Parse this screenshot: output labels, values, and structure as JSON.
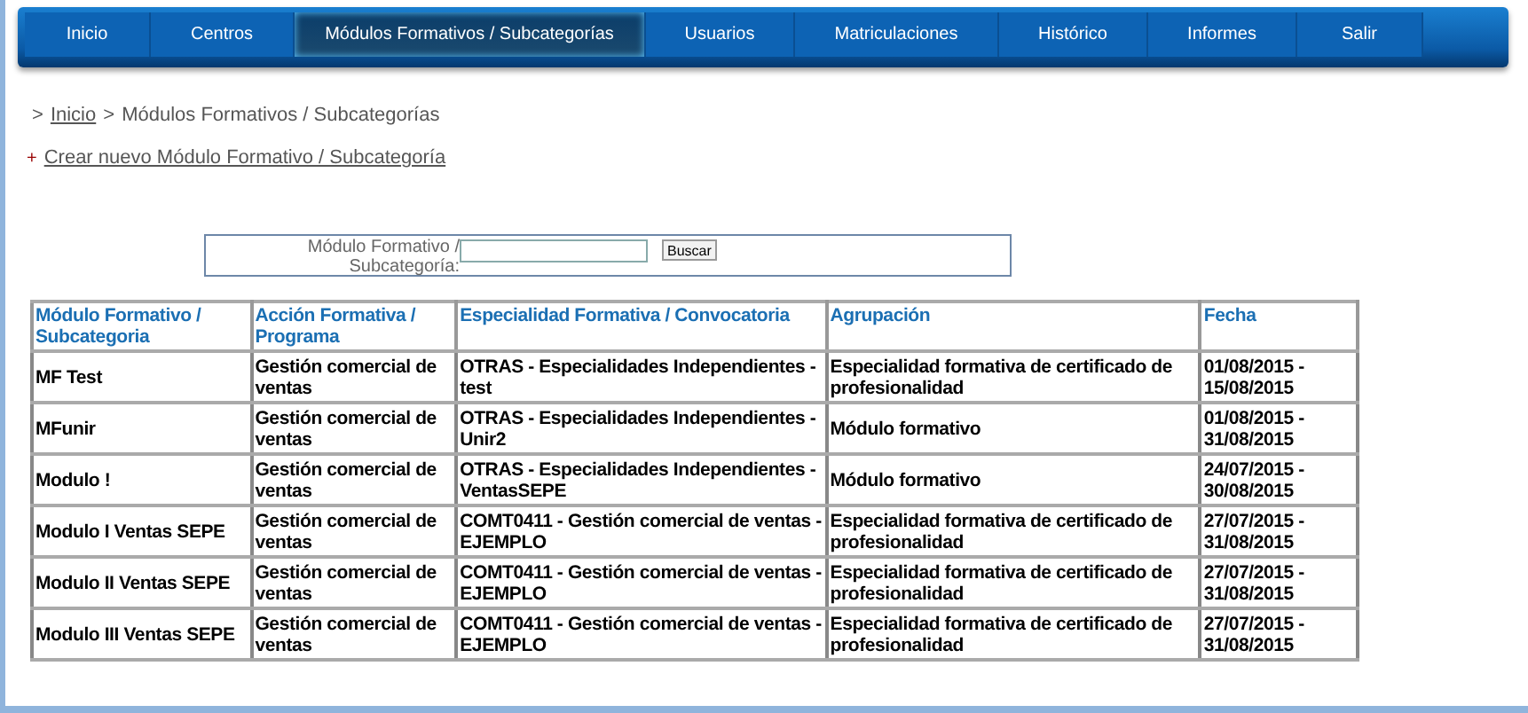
{
  "nav": [
    {
      "label": "Inicio",
      "selected": false
    },
    {
      "label": "Centros",
      "selected": false
    },
    {
      "label": "Módulos Formativos / Subcategorías",
      "selected": true
    },
    {
      "label": "Usuarios",
      "selected": false
    },
    {
      "label": "Matriculaciones",
      "selected": false
    },
    {
      "label": "Histórico",
      "selected": false
    },
    {
      "label": "Informes",
      "selected": false
    },
    {
      "label": "Salir",
      "selected": false
    }
  ],
  "breadcrumb": {
    "separator": ">",
    "link": "Inicio",
    "current": "Módulos Formativos / Subcategorías"
  },
  "create_link": {
    "marker": "+",
    "label": "Crear nuevo Módulo Formativo / Subcategoría"
  },
  "search": {
    "label": "Módulo Formativo / Subcategoría:",
    "button": "Buscar"
  },
  "table": {
    "columns": [
      "Módulo Formativo / Subcategoria",
      "Acción Formativa / Programa",
      "Especialidad Formativa / Convocatoria",
      "Agrupación",
      "Fecha"
    ],
    "rows": [
      [
        "MF Test",
        "Gestión comercial de ventas",
        "OTRAS - Especialidades Independientes - test",
        "Especialidad formativa de certificado de profesionalidad",
        "01/08/2015 - 15/08/2015"
      ],
      [
        "MFunir",
        "Gestión comercial de ventas",
        "OTRAS - Especialidades Independientes - Unir2",
        "Módulo formativo",
        "01/08/2015 - 31/08/2015"
      ],
      [
        "Modulo !",
        "Gestión comercial de ventas",
        "OTRAS - Especialidades Independientes - VentasSEPE",
        "Módulo formativo",
        "24/07/2015 - 30/08/2015"
      ],
      [
        "Modulo I Ventas SEPE",
        "Gestión comercial de ventas",
        "COMT0411 - Gestión comercial de ventas - EJEMPLO",
        "Especialidad formativa de certificado de profesionalidad",
        "27/07/2015 - 31/08/2015"
      ],
      [
        "Modulo II Ventas SEPE",
        "Gestión comercial de ventas",
        "COMT0411 - Gestión comercial de ventas - EJEMPLO",
        "Especialidad formativa de certificado de profesionalidad",
        "27/07/2015 - 31/08/2015"
      ],
      [
        "Modulo III Ventas SEPE",
        "Gestión comercial de ventas",
        "COMT0411 - Gestión comercial de ventas - EJEMPLO",
        "Especialidad formativa de certificado de profesionalidad",
        "27/07/2015 - 31/08/2015"
      ]
    ]
  }
}
